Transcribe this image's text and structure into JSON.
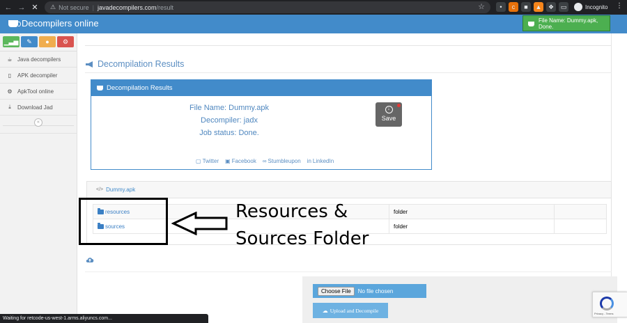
{
  "browser": {
    "security_label": "Not secure",
    "url_host": "javadecompilers.com",
    "url_path": "/result",
    "profile_label": "Incognito",
    "status_text": "Waiting for retcode-us-west-1.arms.aliyuncs.com..."
  },
  "header": {
    "brand": "Decompilers online",
    "file_badge": "File Name: Dummy.apk, Done."
  },
  "sidebar": {
    "shortcut_colors": [
      "#5cb85c",
      "#428bca",
      "#f0ad4e",
      "#d9534f"
    ],
    "items": [
      {
        "icon": "coffee-icon",
        "label": "Java decompilers"
      },
      {
        "icon": "phone-icon",
        "label": "APK decompiler"
      },
      {
        "icon": "gear-icon",
        "label": "ApkTool online"
      },
      {
        "icon": "download-icon",
        "label": "Download Jad"
      }
    ]
  },
  "main": {
    "page_title": "Decompilation Results",
    "panel_title": "Decompilation Results",
    "file_name": "File Name: Dummy.apk",
    "decompiler": "Decompiler: jadx",
    "job_status": "Job status: Done.",
    "save_label": "Save",
    "social": [
      "Twitter",
      "Facebook",
      "Stumbleupon",
      "LinkedIn"
    ],
    "tree_title": "Dummy.apk",
    "rows": [
      {
        "name": "resources",
        "type": "folder"
      },
      {
        "name": "sources",
        "type": "folder"
      }
    ],
    "annotation": [
      "Resources &",
      "Sources Folder"
    ],
    "choose_file_label": "Choose File",
    "no_file_label": "No file chosen",
    "upload_label": "Upload and Decompile",
    "recaptcha_footer": "Privacy - Terms"
  },
  "colors": {
    "primary": "#428bca",
    "success": "#4caf50",
    "link": "#5b8ec2"
  }
}
